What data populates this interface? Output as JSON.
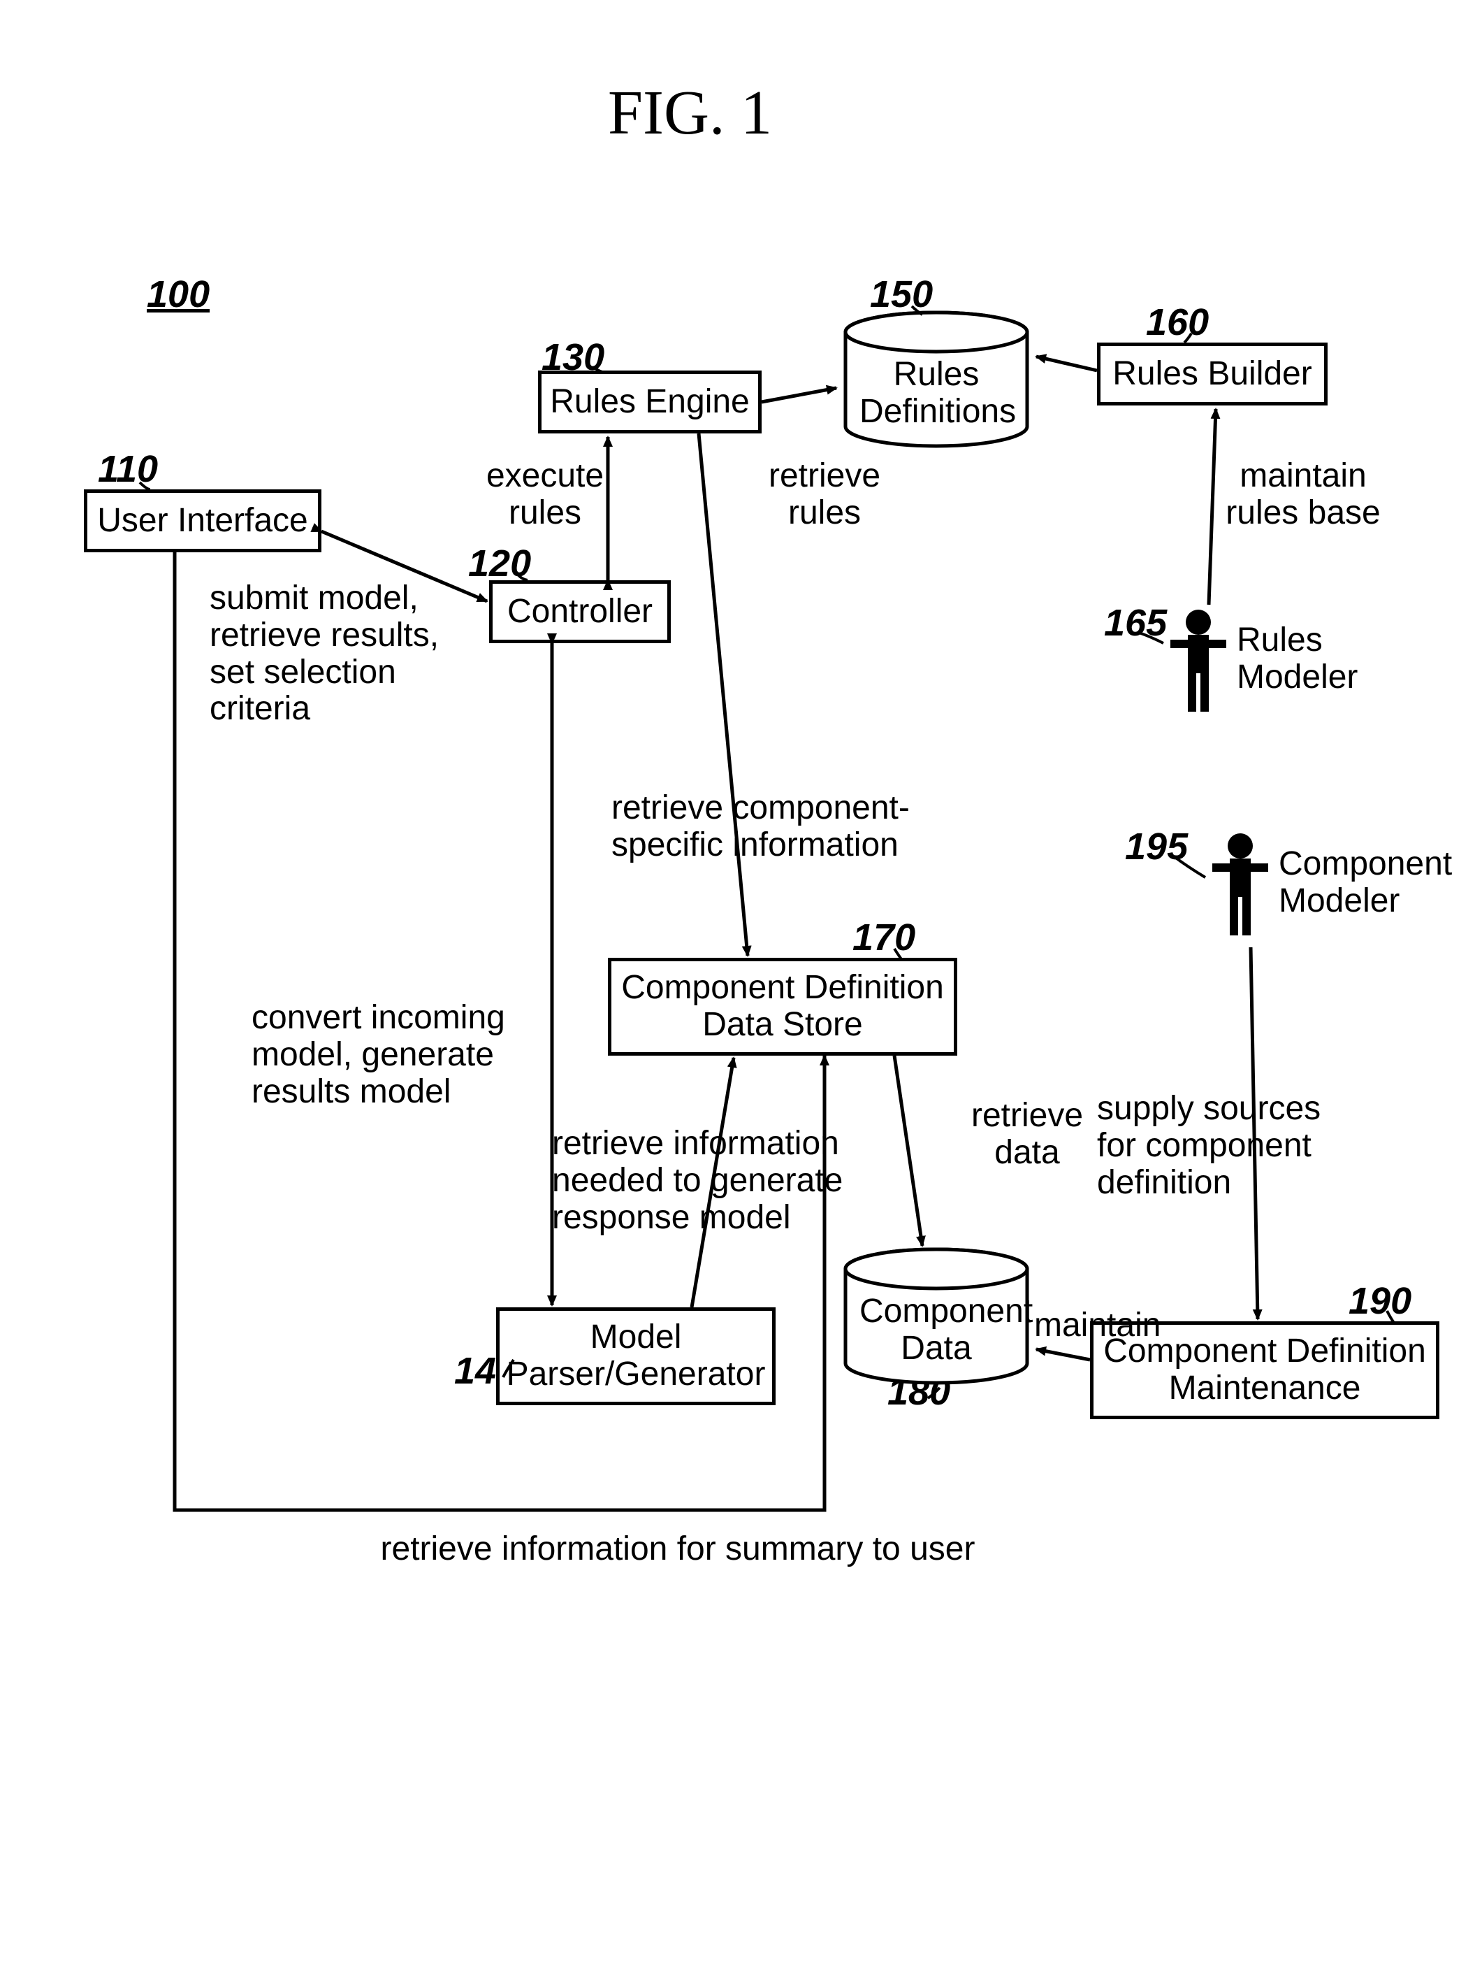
{
  "figure_title": "FIG. 1",
  "refs": {
    "r100": "100",
    "r110": "110",
    "r120": "120",
    "r130": "130",
    "r140": "140",
    "r150": "150",
    "r160": "160",
    "r165": "165",
    "r170": "170",
    "r180": "180",
    "r190": "190",
    "r195": "195"
  },
  "boxes": {
    "user_interface": "User Interface",
    "controller": "Controller",
    "rules_engine": "Rules Engine",
    "model_parser": "Model\nParser/Generator",
    "rules_builder": "Rules Builder",
    "comp_def_store": "Component Definition\nData Store",
    "comp_def_maint": "Component Definition\nMaintenance"
  },
  "cylinders": {
    "rules_definitions": "Rules\nDefinitions",
    "component_data": "Component\nData"
  },
  "actors": {
    "rules_modeler": "Rules\nModeler",
    "component_modeler": "Component\nModeler"
  },
  "edge_labels": {
    "submit_model": "submit model,\nretrieve results,\nset selection criteria",
    "execute_rules": "execute\nrules",
    "retrieve_rules": "retrieve\nrules",
    "maintain_rules_base": "maintain\nrules base",
    "retrieve_comp_specific": "retrieve component-\nspecific information",
    "convert_incoming": "convert incoming\nmodel, generate\nresults model",
    "retrieve_info_needed": "retrieve information\nneeded to generate\nresponse model",
    "retrieve_data": "retrieve\ndata",
    "maintain": "maintain",
    "supply_sources": "supply sources\nfor component\ndefinition",
    "retrieve_info_summary": "retrieve information for summary to user"
  }
}
